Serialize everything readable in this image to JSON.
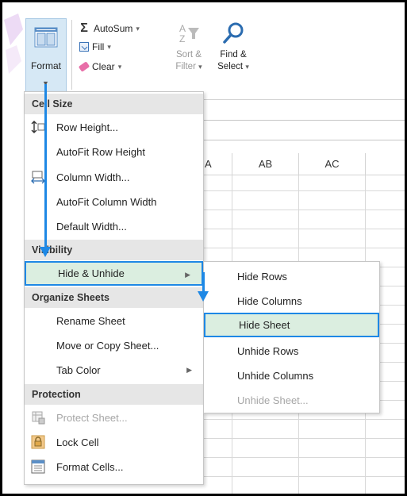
{
  "ribbon": {
    "format_label": "Format",
    "autosum_label": "AutoSum",
    "fill_label": "Fill",
    "clear_label": "Clear",
    "sort_filter_line1": "Sort &",
    "sort_filter_line2": "Filter",
    "find_select_line1": "Find &",
    "find_select_line2": "Select"
  },
  "grid": {
    "columns": [
      "A",
      "AB",
      "AC"
    ]
  },
  "menu": {
    "sections": {
      "cell_size": "Cell Size",
      "visibility": "Visibility",
      "organize_sheets": "Organize Sheets",
      "protection": "Protection"
    },
    "items": {
      "row_height": "Row Height...",
      "autofit_row_height": "AutoFit Row Height",
      "column_width": "Column Width...",
      "autofit_column_width": "AutoFit Column Width",
      "default_width": "Default Width...",
      "hide_unhide": "Hide & Unhide",
      "rename_sheet": "Rename Sheet",
      "move_copy_sheet": "Move or Copy Sheet...",
      "tab_color": "Tab Color",
      "protect_sheet": "Protect Sheet...",
      "lock_cell": "Lock Cell",
      "format_cells": "Format Cells..."
    }
  },
  "submenu": {
    "items": {
      "hide_rows": "Hide Rows",
      "hide_columns": "Hide Columns",
      "hide_sheet": "Hide Sheet",
      "unhide_rows": "Unhide Rows",
      "unhide_columns": "Unhide Columns",
      "unhide_sheet": "Unhide Sheet..."
    }
  },
  "colors": {
    "highlight": "#dbeee0",
    "arrow": "#1e88e5",
    "section_bg": "#e6e6e6",
    "disabled_text": "#a6a6a6"
  }
}
